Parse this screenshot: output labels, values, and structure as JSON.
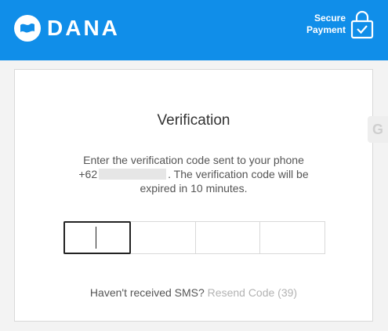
{
  "header": {
    "brand": "DANA",
    "secure_line1": "Secure",
    "secure_line2": "Payment",
    "colors": {
      "bar": "#108ee9",
      "text": "#ffffff"
    },
    "icons": {
      "logo": "dana-logo-icon",
      "lock": "padlock-check-icon"
    }
  },
  "verification": {
    "title": "Verification",
    "desc_before": "Enter the verification code sent to your phone +62",
    "desc_after": ". The verification code will be expired in 10 minutes.",
    "code_boxes": [
      "",
      "",
      "",
      ""
    ],
    "resend_prompt": "Haven't received SMS?",
    "resend_link": "Resend Code (39)"
  }
}
